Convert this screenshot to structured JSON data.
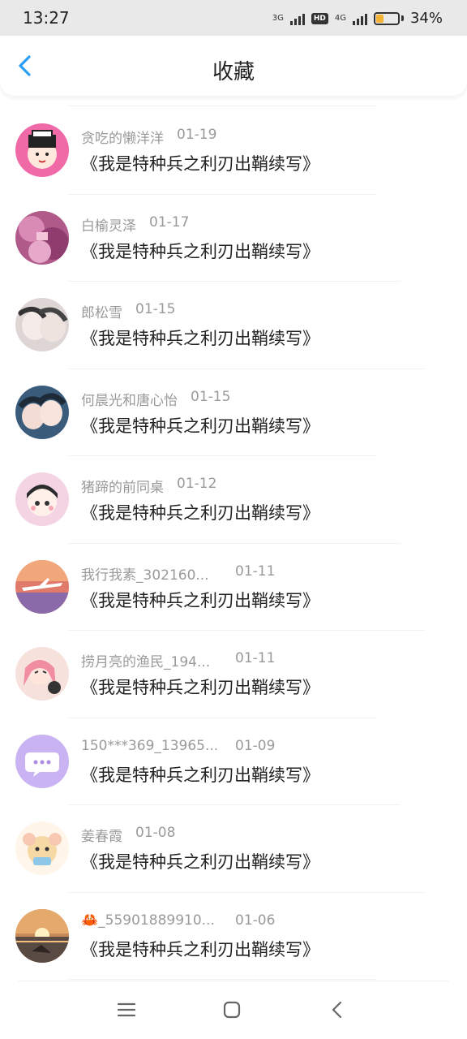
{
  "status_bar": {
    "time": "13:27",
    "network_1": "3G",
    "hd": "HD",
    "network_2": "4G",
    "battery_level": 34,
    "battery_text": "34%"
  },
  "header": {
    "title": "收藏",
    "back_icon": "chevron-left-icon"
  },
  "colors": {
    "accent": "#2a9df4",
    "battery": "#f2b232",
    "meta_text": "#9a9a9a"
  },
  "favorites": [
    {
      "user": "贪吃的懒洋洋",
      "date": "01-19",
      "title": "《我是特种兵之利刃出鞘续写》"
    },
    {
      "user": "白榆灵泽",
      "date": "01-17",
      "title": "《我是特种兵之利刃出鞘续写》"
    },
    {
      "user": "郎松雪",
      "date": "01-15",
      "title": "《我是特种兵之利刃出鞘续写》"
    },
    {
      "user": "何晨光和唐心怡",
      "date": "01-15",
      "title": "《我是特种兵之利刃出鞘续写》"
    },
    {
      "user": "猪蹄的前同桌",
      "date": "01-12",
      "title": "《我是特种兵之利刃出鞘续写》"
    },
    {
      "user": "我行我素_302160...",
      "date": "01-11",
      "title": "《我是特种兵之利刃出鞘续写》"
    },
    {
      "user": "捞月亮的渔民_194...",
      "date": "01-11",
      "title": "《我是特种兵之利刃出鞘续写》"
    },
    {
      "user": "150***369_13965...",
      "date": "01-09",
      "title": "《我是特种兵之利刃出鞘续写》"
    },
    {
      "user": "姜春霞",
      "date": "01-08",
      "title": "《我是特种兵之利刃出鞘续写》"
    },
    {
      "user": "🦀_55901889910...",
      "date": "01-06",
      "title": "《我是特种兵之利刃出鞘续写》"
    }
  ],
  "nav_bar": {
    "menu_icon": "menu-icon",
    "home_icon": "home-icon",
    "back_icon": "back-icon"
  }
}
